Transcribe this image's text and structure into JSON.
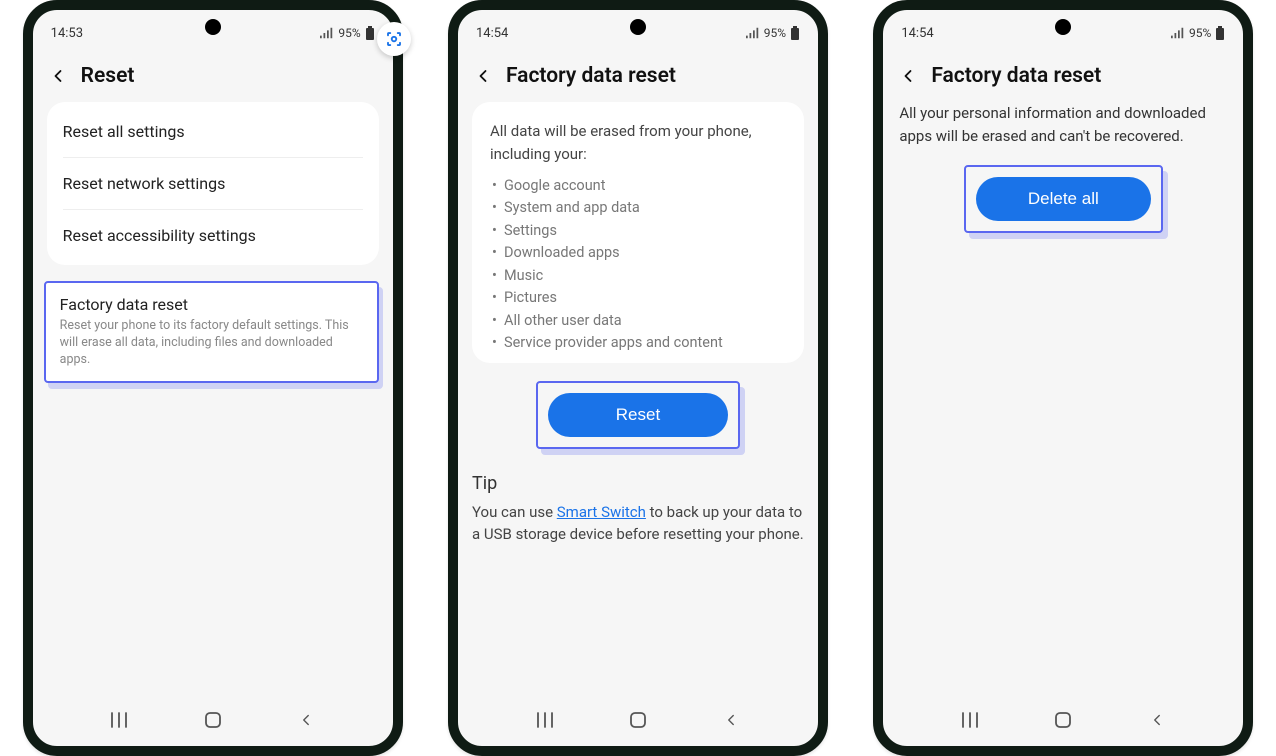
{
  "phones": [
    {
      "status": {
        "time": "14:53",
        "battery_text": "95%"
      },
      "header": {
        "title": "Reset"
      },
      "list_items": [
        {
          "label": "Reset all settings"
        },
        {
          "label": "Reset network settings"
        },
        {
          "label": "Reset accessibility settings"
        }
      ],
      "factory_reset": {
        "title": "Factory data reset",
        "subtitle": "Reset your phone to its factory default settings. This will erase all data, including files and downloaded apps."
      }
    },
    {
      "status": {
        "time": "14:54",
        "battery_text": "95%"
      },
      "header": {
        "title": "Factory data reset"
      },
      "intro": "All data will be erased from your phone, including your:",
      "bullets": [
        "Google account",
        "System and app data",
        "Settings",
        "Downloaded apps",
        "Music",
        "Pictures",
        "All other user data",
        "Service provider apps and content"
      ],
      "button_label": "Reset",
      "tip": {
        "heading": "Tip",
        "pre": "You can use ",
        "link": "Smart Switch",
        "post": " to back up your data to a USB storage device before resetting your phone."
      }
    },
    {
      "status": {
        "time": "14:54",
        "battery_text": "95%"
      },
      "header": {
        "title": "Factory data reset"
      },
      "warning": "All your personal information and downloaded apps will be erased and can't be recovered.",
      "button_label": "Delete all"
    }
  ]
}
